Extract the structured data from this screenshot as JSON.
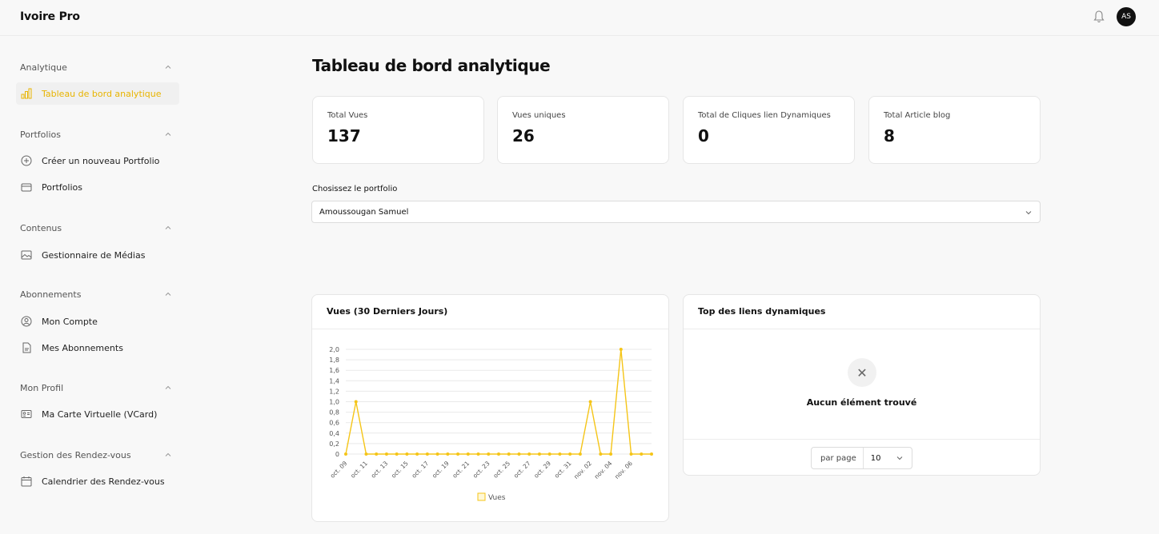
{
  "app": {
    "title": "Ivoire Pro",
    "avatar_initials": "AS"
  },
  "sidebar": {
    "sections": [
      {
        "title": "Analytique",
        "items": [
          {
            "label": "Tableau de bord analytique",
            "icon": "bar-chart-icon",
            "active": true
          }
        ]
      },
      {
        "title": "Portfolios",
        "items": [
          {
            "label": "Créer un nouveau Portfolio",
            "icon": "plus-circle-icon"
          },
          {
            "label": "Portfolios",
            "icon": "folder-icon"
          }
        ]
      },
      {
        "title": "Contenus",
        "items": [
          {
            "label": "Gestionnaire de Médias",
            "icon": "image-icon"
          }
        ]
      },
      {
        "title": "Abonnements",
        "items": [
          {
            "label": "Mon Compte",
            "icon": "user-circle-icon"
          },
          {
            "label": "Mes Abonnements",
            "icon": "document-icon"
          }
        ]
      },
      {
        "title": "Mon Profil",
        "items": [
          {
            "label": "Ma Carte Virtuelle (VCard)",
            "icon": "id-card-icon"
          }
        ]
      },
      {
        "title": "Gestion des Rendez-vous",
        "items": [
          {
            "label": "Calendrier des Rendez-vous",
            "icon": "calendar-icon"
          }
        ]
      }
    ]
  },
  "main": {
    "title": "Tableau de bord analytique",
    "stats": [
      {
        "label": "Total Vues",
        "value": "137"
      },
      {
        "label": "Vues uniques",
        "value": "26"
      },
      {
        "label": "Total de Cliques lien Dynamiques",
        "value": "0"
      },
      {
        "label": "Total Article blog",
        "value": "8"
      }
    ],
    "portfolio_select": {
      "label": "Chosissez le portfolio",
      "value": "Amoussougan Samuel"
    },
    "views_card": {
      "title": "Vues (30 Derniers Jours)"
    },
    "links_card": {
      "title": "Top des liens dynamiques",
      "empty_text": "Aucun élément trouvé",
      "per_page_label": "par page",
      "per_page_value": "10"
    }
  },
  "colors": {
    "accent": "#f5c518",
    "accent_text": "#e8b400"
  },
  "chart_data": {
    "type": "line",
    "title": "Vues (30 Derniers Jours)",
    "x": [
      "oct. 09",
      "oct. 10",
      "oct. 11",
      "oct. 12",
      "oct. 13",
      "oct. 14",
      "oct. 15",
      "oct. 16",
      "oct. 17",
      "oct. 18",
      "oct. 19",
      "oct. 20",
      "oct. 21",
      "oct. 22",
      "oct. 23",
      "oct. 24",
      "oct. 25",
      "oct. 26",
      "oct. 27",
      "oct. 28",
      "oct. 29",
      "oct. 30",
      "oct. 31",
      "nov. 01",
      "nov. 02",
      "nov. 03",
      "nov. 04",
      "nov. 05",
      "nov. 06",
      "nov. 07"
    ],
    "x_tick_labels": [
      "oct. 09",
      "oct. 11",
      "oct. 13",
      "oct. 15",
      "oct. 17",
      "oct. 19",
      "oct. 21",
      "oct. 23",
      "oct. 25",
      "oct. 27",
      "oct. 29",
      "oct. 31",
      "nov. 02",
      "nov. 04",
      "nov. 06"
    ],
    "series": [
      {
        "name": "Vues",
        "color": "#f5c518",
        "values": [
          0,
          1,
          0,
          0,
          0,
          0,
          0,
          0,
          0,
          0,
          0,
          0,
          0,
          0,
          0,
          0,
          0,
          0,
          0,
          0,
          0,
          0,
          0,
          0,
          1,
          0,
          0,
          2,
          0,
          0,
          0
        ]
      }
    ],
    "y_ticks": [
      "0",
      "0,2",
      "0,4",
      "0,6",
      "0,8",
      "1,0",
      "1,2",
      "1,4",
      "1,6",
      "1,8",
      "2,0"
    ],
    "ylim": [
      0,
      2
    ],
    "grid": true,
    "legend": "bottom"
  }
}
